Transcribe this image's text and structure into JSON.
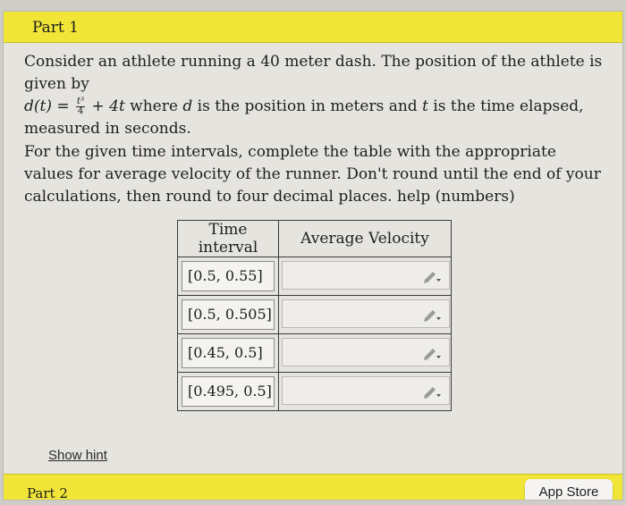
{
  "part1": {
    "label": "Part 1"
  },
  "intro": {
    "sentence1": "Consider an athlete running a 40 meter dash. The position of the athlete is given by",
    "d_of_t": "d(t)",
    "equals": " = ",
    "frac_num": "t³",
    "frac_den": "4",
    "plus_term": " + 4t",
    "where": " where ",
    "d": "d",
    "is_position": " is the position in meters and ",
    "t": "t",
    "rest": " is the time elapsed, measured in seconds."
  },
  "instructions": {
    "text": "For the given time intervals, complete the table with the appropriate values for average velocity of the runner. Don't round until the end of your calculations, then round to four decimal places. ",
    "help_link": "help (numbers)"
  },
  "table": {
    "headers": [
      "Time interval",
      "Average Velocity"
    ],
    "rows": [
      {
        "interval": "[0.5, 0.55]",
        "value": ""
      },
      {
        "interval": "[0.5, 0.505]",
        "value": ""
      },
      {
        "interval": "[0.45, 0.5]",
        "value": ""
      },
      {
        "interval": "[0.495, 0.5]",
        "value": ""
      }
    ]
  },
  "show_hint": "Show hint",
  "part2": {
    "label": "Part 2"
  },
  "appstore": {
    "label": "App Store"
  },
  "colors": {
    "header_yellow": "#f1e637",
    "panel_bg": "#e6e4df"
  }
}
